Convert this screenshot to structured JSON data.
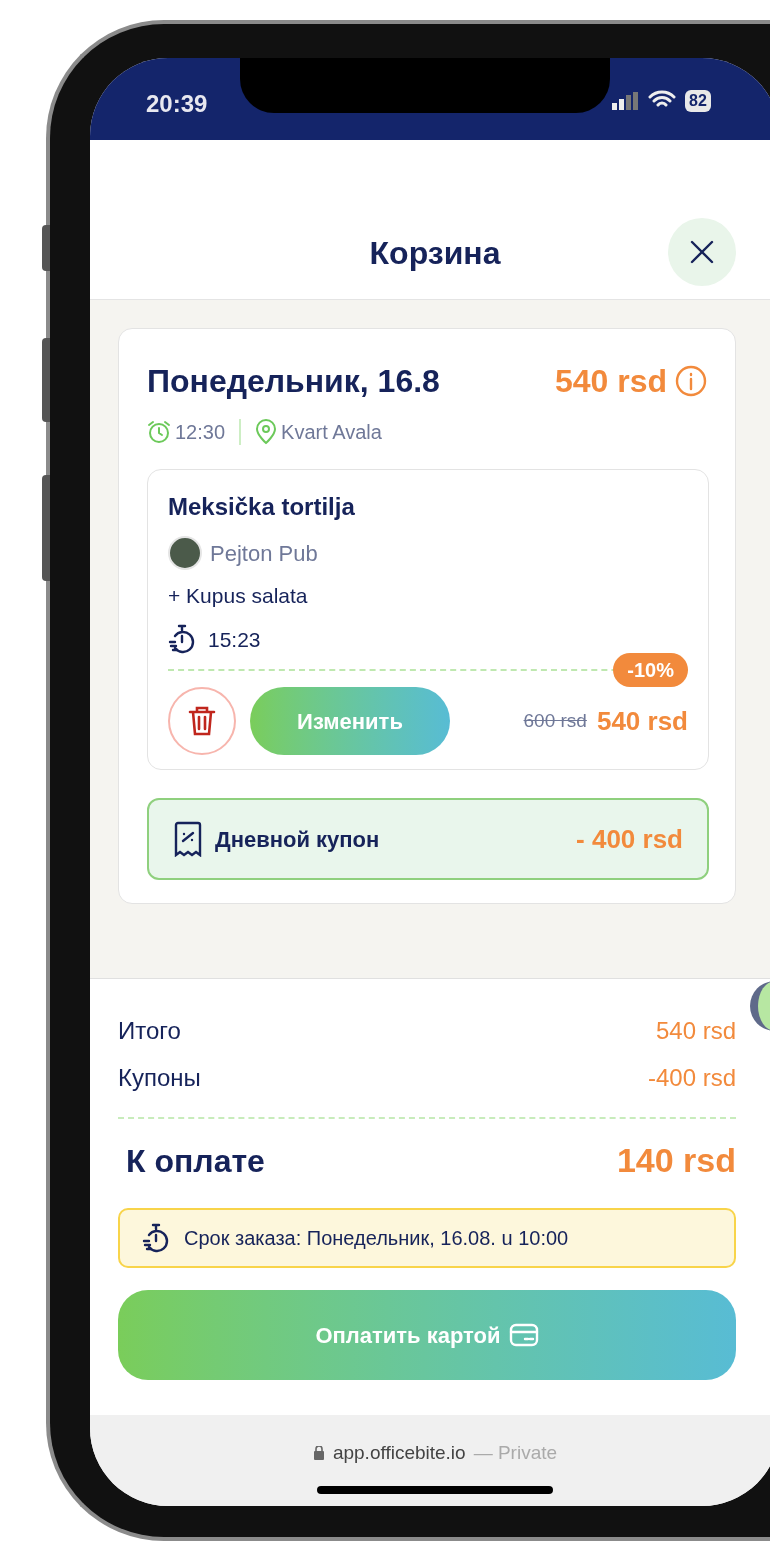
{
  "status_bar": {
    "time": "20:39",
    "battery": "82"
  },
  "header": {
    "title": "Корзина"
  },
  "day": {
    "title": "Понедельник, 16.8",
    "total": "540 rsd",
    "time": "12:30",
    "location": "Kvart Avala",
    "items": [
      {
        "name": "Meksička tortilja",
        "restaurant": "Pejton Pub",
        "extras": [
          "+ Kupus salata"
        ],
        "ready_time": "15:23",
        "discount": "-10%",
        "old_price": "600 rsd",
        "price": "540 rsd",
        "edit_label": "Изменить"
      }
    ],
    "coupon": {
      "label": "Дневной купон",
      "amount": "- 400 rsd"
    }
  },
  "summary": {
    "lines": [
      {
        "label": "Итого",
        "value": "540 rsd"
      },
      {
        "label": "Купоны",
        "value": "-400 rsd"
      }
    ],
    "total_label": "К оплате",
    "total_value": "140 rsd",
    "deadline": "Срок заказа: Понедельник, 16.08. u 10:00",
    "pay_label": "Оплатить картой"
  },
  "browser": {
    "url": "app.officebite.io",
    "mode": "— Private"
  }
}
